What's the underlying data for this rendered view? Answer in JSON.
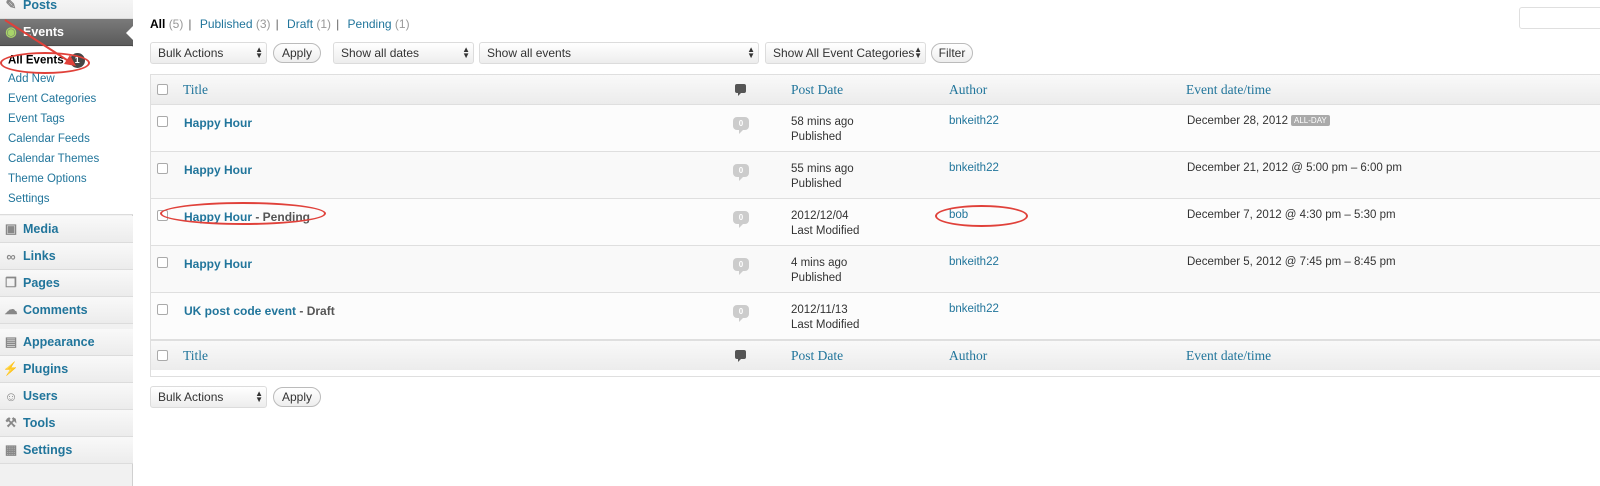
{
  "sidebar": {
    "top_items": [
      {
        "label": "Posts",
        "icon": "pin-icon"
      },
      {
        "label": "Events",
        "icon": "calendar-icon"
      }
    ],
    "submenu": [
      {
        "label": "All Events",
        "badge": "1"
      },
      {
        "label": "Add New"
      },
      {
        "label": "Event Categories"
      },
      {
        "label": "Event Tags"
      },
      {
        "label": "Calendar Feeds"
      },
      {
        "label": "Calendar Themes"
      },
      {
        "label": "Theme Options"
      },
      {
        "label": "Settings"
      }
    ],
    "lower_items": [
      {
        "label": "Media",
        "icon": "media-icon"
      },
      {
        "label": "Links",
        "icon": "link-icon"
      },
      {
        "label": "Pages",
        "icon": "pages-icon"
      },
      {
        "label": "Comments",
        "icon": "comments-icon"
      },
      {
        "label": "Appearance",
        "icon": "appearance-icon"
      },
      {
        "label": "Plugins",
        "icon": "plugin-icon"
      },
      {
        "label": "Users",
        "icon": "users-icon"
      },
      {
        "label": "Tools",
        "icon": "tools-icon"
      },
      {
        "label": "Settings",
        "icon": "settings-icon"
      }
    ]
  },
  "filters": {
    "views": [
      {
        "label": "All",
        "count": "(5)"
      },
      {
        "label": "Published",
        "count": "(3)"
      },
      {
        "label": "Draft",
        "count": "(1)"
      },
      {
        "label": "Pending",
        "count": "(1)"
      }
    ],
    "bulk_actions": "Bulk Actions",
    "apply": "Apply",
    "dates": "Show all dates",
    "events": "Show all events",
    "categories": "Show All Event Categories",
    "filter": "Filter"
  },
  "table": {
    "columns": {
      "title": "Title",
      "post_date": "Post Date",
      "author": "Author",
      "event_datetime": "Event date/time"
    },
    "rows": [
      {
        "title": "Happy Hour",
        "suffix": "",
        "comments": "0",
        "date": "58 mins ago",
        "status": "Published",
        "author": "bnkeith22",
        "event": "December 28, 2012",
        "all_day": "ALL-DAY"
      },
      {
        "title": "Happy Hour",
        "suffix": "",
        "comments": "0",
        "date": "55 mins ago",
        "status": "Published",
        "author": "bnkeith22",
        "event": "December 21, 2012 @ 5:00 pm – 6:00 pm",
        "all_day": ""
      },
      {
        "title": "Happy Hour",
        "suffix": " - Pending",
        "comments": "0",
        "date": "2012/12/04",
        "status": "Last Modified",
        "author": "bob",
        "event": "December 7, 2012 @ 4:30 pm – 5:30 pm",
        "all_day": ""
      },
      {
        "title": "Happy Hour",
        "suffix": "",
        "comments": "0",
        "date": "4 mins ago",
        "status": "Published",
        "author": "bnkeith22",
        "event": "December 5, 2012 @ 7:45 pm – 8:45 pm",
        "all_day": ""
      },
      {
        "title": "UK post code event",
        "suffix": " - Draft",
        "comments": "0",
        "date": "2012/11/13",
        "status": "Last Modified",
        "author": "bnkeith22",
        "event": "",
        "all_day": ""
      }
    ]
  },
  "bottom": {
    "bulk_actions": "Bulk Actions",
    "apply": "Apply"
  },
  "colors": {
    "link": "#21759b",
    "annotation": "#e0413a",
    "current_menu": "#5b5b5b"
  }
}
